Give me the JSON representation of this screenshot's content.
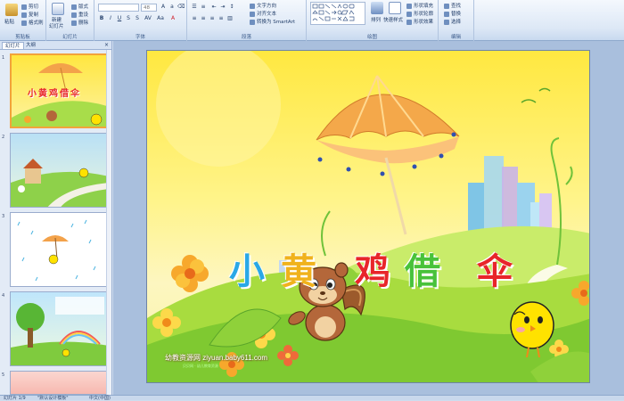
{
  "ribbon": {
    "clipboard": {
      "paste_label": "粘贴",
      "cut_label": "剪切",
      "copy_label": "复制",
      "format_painter_label": "格式刷",
      "group_label": "剪贴板"
    },
    "slides": {
      "new_slide_label": "新建",
      "new_slide_label2": "幻灯片",
      "layout_label": "版式",
      "reset_label": "重设",
      "delete_label": "删除",
      "group_label": "幻灯片"
    },
    "font": {
      "font_name_value": "",
      "font_size_value": "48",
      "group_label": "字体"
    },
    "paragraph": {
      "text_direction_label": "文字方向",
      "align_text_label": "对齐文本",
      "smartart_label": "转换为 SmartArt",
      "group_label": "段落"
    },
    "drawing": {
      "arrange_label": "排列",
      "quick_styles_label": "快速样式",
      "shape_fill_label": "形状填充",
      "shape_outline_label": "形状轮廓",
      "shape_effects_label": "形状效果",
      "group_label": "绘图"
    },
    "editing": {
      "find_label": "查找",
      "replace_label": "替换",
      "select_label": "选择",
      "group_label": "编辑"
    }
  },
  "pane": {
    "tab_slides": "幻灯片",
    "tab_outline": "大纲",
    "close": "×",
    "thumbnails": [
      {
        "number": "1",
        "selected": true,
        "title": "小黄鸡借伞"
      },
      {
        "number": "2",
        "selected": false
      },
      {
        "number": "3",
        "selected": false
      },
      {
        "number": "4",
        "selected": false
      },
      {
        "number": "5",
        "selected": false
      }
    ]
  },
  "slide": {
    "title_chars": [
      "小",
      "黄",
      "鸡",
      "借",
      "伞"
    ],
    "title_colors": [
      "#2aa8e6",
      "#f0b21c",
      "#e8252a",
      "#48c23a",
      "#e8252a"
    ],
    "watermark": "幼教资源网 ziyuan.baby611.com",
    "watermark_sub": "贝贝网 · 幼儿教育资源"
  },
  "status": {
    "slide_counter": "幻灯片 1/9",
    "theme": "\"默认设计模板\"",
    "language": "中文(中国)"
  }
}
